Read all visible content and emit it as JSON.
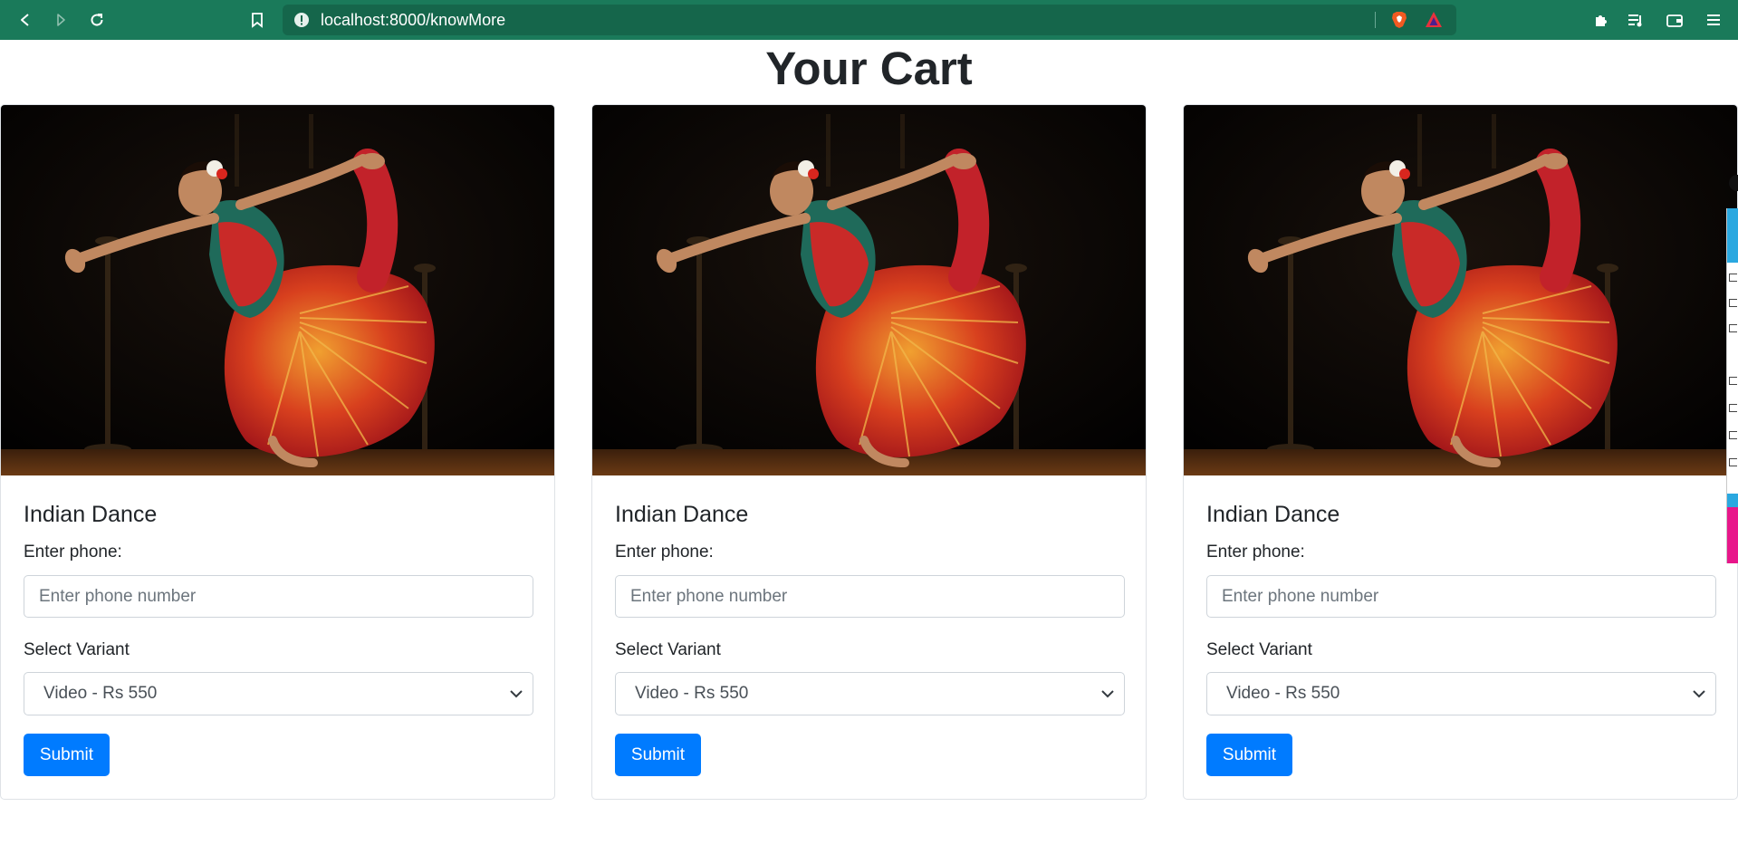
{
  "browser": {
    "url": "localhost:8000/knowMore",
    "icons": [
      "back-icon",
      "forward-icon",
      "reload-icon",
      "bookmark-icon",
      "site-info-icon",
      "brave-shield-icon",
      "brave-rewards-icon",
      "extensions-icon",
      "media-playlist-icon",
      "wallet-icon",
      "menu-icon"
    ],
    "accent_color": "#1a7a5a"
  },
  "page": {
    "title": "Your Cart"
  },
  "cards": [
    {
      "title": "Indian Dance",
      "phone_label": "Enter phone:",
      "phone_placeholder": "Enter phone number",
      "phone_value": "",
      "variant_label": "Select Variant",
      "variant_selected": "Video - Rs 550",
      "submit_label": "Submit"
    },
    {
      "title": "Indian Dance",
      "phone_label": "Enter phone:",
      "phone_placeholder": "Enter phone number",
      "phone_value": "",
      "variant_label": "Select Variant",
      "variant_selected": "Video - Rs 550",
      "submit_label": "Submit"
    },
    {
      "title": "Indian Dance",
      "phone_label": "Enter phone:",
      "phone_placeholder": "Enter phone number",
      "phone_value": "",
      "variant_label": "Select Variant",
      "variant_selected": "Video - Rs 550",
      "submit_label": "Submit"
    }
  ],
  "colors": {
    "primary_button": "#007bff",
    "card_border": "#dee2e6"
  }
}
